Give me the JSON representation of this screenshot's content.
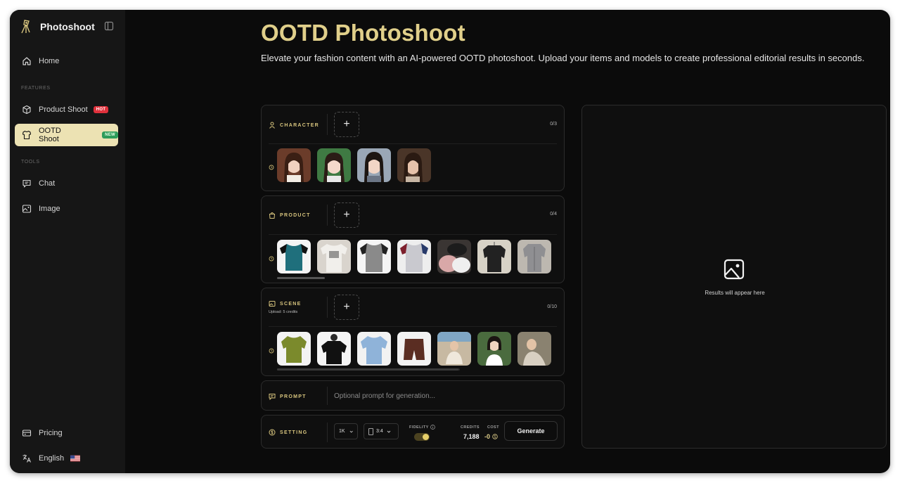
{
  "sidebar": {
    "brand": "Photoshoot",
    "home": "Home",
    "features_label": "FEATURES",
    "product_shoot": "Product Shoot",
    "product_badge": "HOT",
    "ootd_shoot": "OOTD Shoot",
    "ootd_badge": "NEW",
    "tools_label": "TOOLS",
    "chat": "Chat",
    "image": "Image",
    "pricing": "Pricing",
    "language": "English"
  },
  "header": {
    "title": "OOTD Photoshoot",
    "subtitle": "Elevate your fashion content with an AI-powered OOTD photoshoot. Upload your items and models to create professional editorial results in seconds."
  },
  "character": {
    "label": "CHARACTER",
    "count": "0/3"
  },
  "product": {
    "label": "PRODUCT",
    "count": "0/4"
  },
  "scene": {
    "label": "SCENE",
    "note": "Upload: 5 credits",
    "count": "0/10"
  },
  "prompt": {
    "label": "PROMPT",
    "placeholder": "Optional prompt for generation..."
  },
  "setting": {
    "label": "SETTING",
    "resolution": "1K",
    "ratio": "3:4",
    "fidelity_label": "FIDELITY",
    "credits_label": "CREDITS",
    "credits_value": "7,188",
    "cost_label": "COST",
    "cost_value": "-0",
    "generate": "Generate"
  },
  "results": {
    "placeholder": "Results will appear here"
  },
  "colors": {
    "accent": "#e0cf8a",
    "active_nav": "#ece2b3",
    "hot": "#e0313c",
    "new": "#2e9c5b",
    "background": "#0b0b0b"
  }
}
